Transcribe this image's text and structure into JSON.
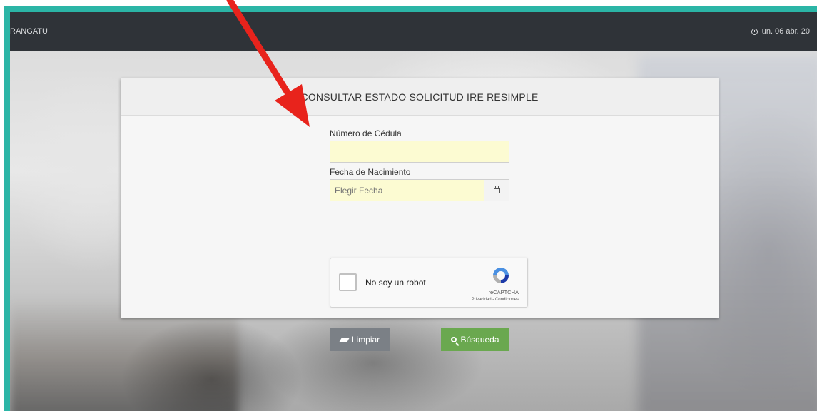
{
  "header": {
    "brand": "RANGATU",
    "clock": "lun. 06 abr. 20",
    "clock_icon": "clock-icon"
  },
  "form": {
    "title": "CONSULTAR ESTADO SOLICITUD IRE RESIMPLE",
    "cedula_label": "Número de Cédula",
    "cedula_value": "",
    "fecha_label": "Fecha de Nacimiento",
    "fecha_placeholder": "Elegir Fecha",
    "calendar_icon": "calendar-icon"
  },
  "recaptcha": {
    "label": "No soy un robot",
    "brand": "reCAPTCHA",
    "links": "Privacidad - Condiciones"
  },
  "buttons": {
    "clear_label": "Limpiar",
    "search_label": "Búsqueda"
  },
  "colors": {
    "frame": "#2bb5a6",
    "topbar": "#2f3338",
    "input_bg": "#fcfbd2",
    "clear_button": "#7b8086",
    "search_button": "#6aa84f",
    "arrow": "#e8231c"
  }
}
